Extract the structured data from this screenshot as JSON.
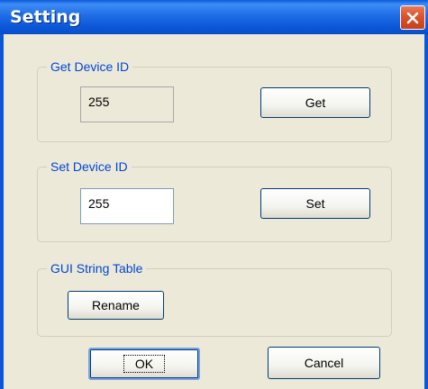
{
  "window": {
    "title": "Setting",
    "close_icon": "close-icon"
  },
  "get_device_id": {
    "legend": "Get Device ID",
    "value": "255",
    "button_label": "Get"
  },
  "set_device_id": {
    "legend": "Set Device ID",
    "value": "255",
    "button_label": "Set"
  },
  "gui_string_table": {
    "legend": "GUI String Table",
    "button_label": "Rename"
  },
  "footer": {
    "ok_label": "OK",
    "cancel_label": "Cancel"
  },
  "colors": {
    "title_bar": "#0b56d8",
    "close_button": "#d9532d",
    "legend_text": "#0046d5",
    "dialog_bg": "#ece9d8"
  }
}
